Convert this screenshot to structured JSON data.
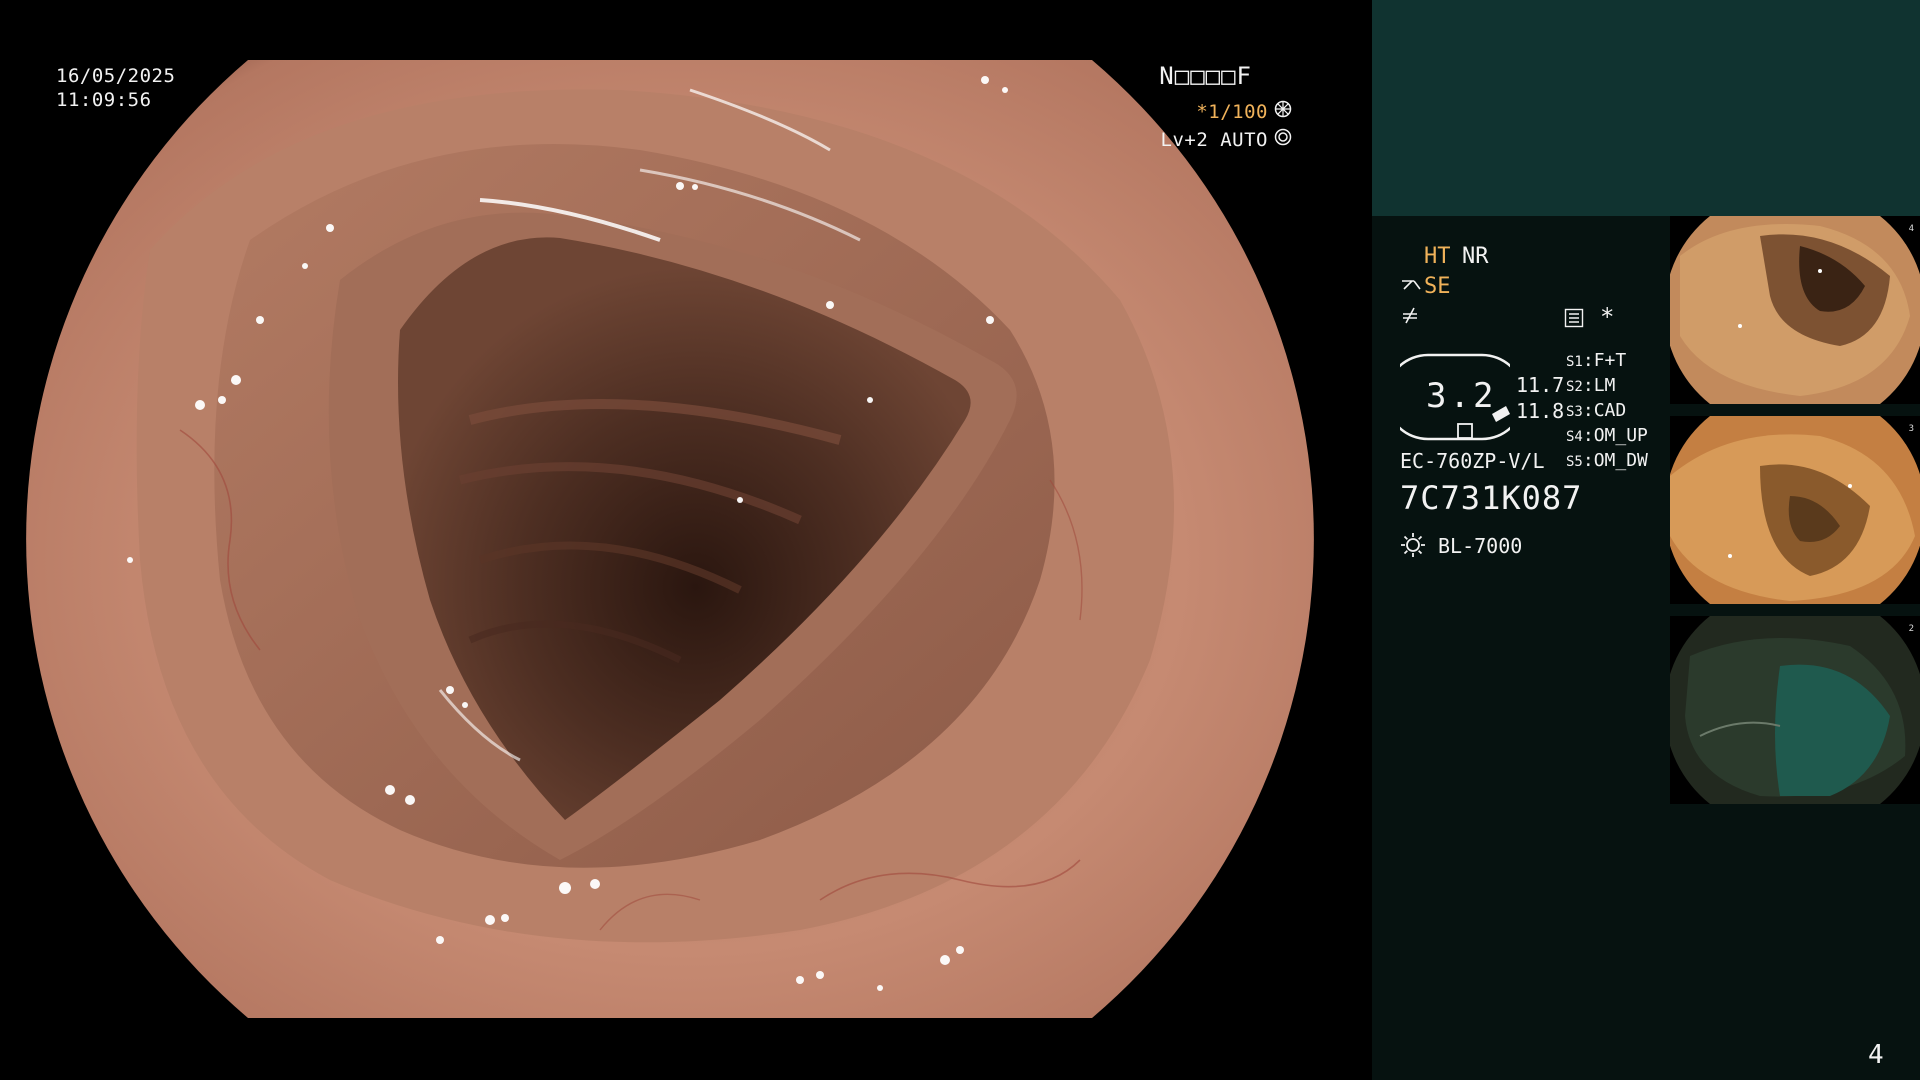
{
  "osd": {
    "date": "16/05/2025",
    "time": "11:09:56",
    "patient_field": "N□□□□F",
    "shutter": "*1/100",
    "shutter_icon": "aperture-icon",
    "iris": "Lv+2 AUTO",
    "iris_icon": "iris-icon"
  },
  "panel": {
    "ht": "HT",
    "nr": "NR",
    "se": "SE",
    "se_icon": "structure-enhance-icon",
    "enhance_icon": "edge-enhance-icon",
    "settings_icon": "settings-list-icon",
    "asterisk": "*",
    "zoom": "3.2",
    "zoom_min": "11.7",
    "zoom_max": "11.8",
    "switches": [
      {
        "key": "S1",
        "value": "F+T"
      },
      {
        "key": "S2",
        "value": "LM"
      },
      {
        "key": "S3",
        "value": "CAD"
      },
      {
        "key": "S4",
        "value": "OM_UP"
      },
      {
        "key": "S5",
        "value": "OM_DW"
      }
    ],
    "scope_model": "EC-760ZP-V/L",
    "serial": "7C731K087",
    "lamp_icon": "light-source-icon",
    "lamp": "BL-7000"
  },
  "thumbnails": [
    {
      "number": "4"
    },
    {
      "number": "3"
    },
    {
      "number": "2"
    }
  ],
  "page_number": "4",
  "colors": {
    "panel_top": "#103330",
    "panel_bg": "#061210",
    "accent": "#f0b25a",
    "text": "#f2f2f2"
  }
}
